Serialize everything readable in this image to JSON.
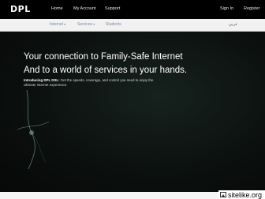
{
  "brand": {
    "logo": "DPL"
  },
  "topnav": {
    "home": "Home",
    "my_account": "My Account",
    "support": "Support",
    "sign_in": "Sign In",
    "register": "Register"
  },
  "subnav": {
    "internet": "Internet",
    "services": "Services",
    "students": "Students",
    "language": "عربي"
  },
  "hero": {
    "headline_1": "Your connection to Family-Safe Internet",
    "headline_2": "And to a world of services in your hands.",
    "intro_bold": "Introducing DPL DSL:",
    "intro_text": " Get the speeds, coverage, and control you need to enjoy the ultimate Internet experience."
  },
  "watermark": {
    "text": "sitelike.org"
  }
}
